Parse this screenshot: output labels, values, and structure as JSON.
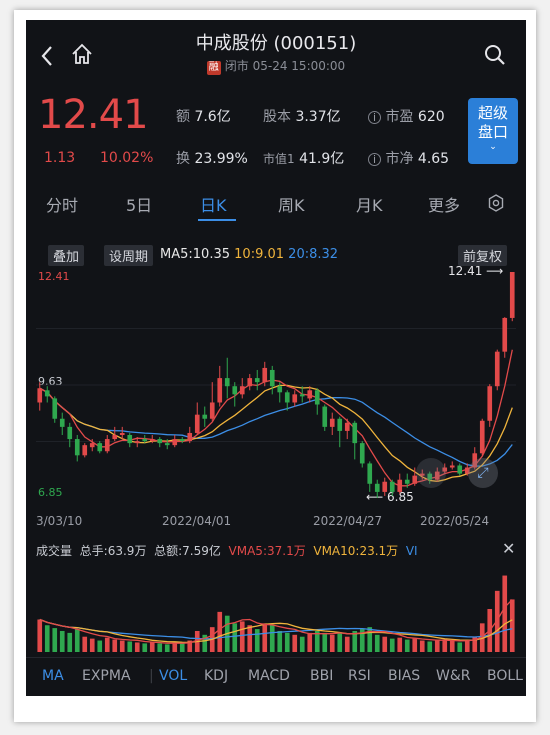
{
  "header": {
    "title": "中成股份 (000151)",
    "badge": "融",
    "status": "闭市 05-24 15:00:00"
  },
  "quote": {
    "price": "12.41",
    "change": "1.13",
    "change_pct": "10.02%",
    "stats": [
      {
        "label": "额",
        "value": "7.6亿"
      },
      {
        "label": "股本",
        "value": "3.37亿"
      },
      {
        "label": "市盈",
        "value": "620"
      },
      {
        "label": "换",
        "value": "23.99%"
      },
      {
        "label": "市值",
        "value": "41.9亿"
      },
      {
        "label": "市净",
        "value": "4.65"
      }
    ],
    "mktcap_suffix": "1",
    "super_button": [
      "超级",
      "盘口"
    ]
  },
  "tabs": [
    "分时",
    "5日",
    "日K",
    "周K",
    "月K",
    "更多"
  ],
  "active_tab": "日K",
  "chart_toolbar": {
    "overlay": "叠加",
    "period": "设周期",
    "ma_label": "MA5",
    "ma5": "10.35",
    "ma10_label": "10",
    "ma10": "9.01",
    "ma20_label": "20",
    "ma20": "8.32",
    "adjust": "前复权"
  },
  "price_axis": {
    "top": "12.41",
    "mid": "9.63",
    "bottom": "6.85",
    "high_marker": "12.41",
    "low_marker": "6.85"
  },
  "date_axis": [
    "3/03/10",
    "2022/04/01",
    "2022/04/27",
    "2022/05/24"
  ],
  "volume_header": {
    "title": "成交量",
    "hands_label": "总手",
    "hands": "63.9万",
    "amount_label": "总额",
    "amount": "7.59亿",
    "vma5_label": "VMA5",
    "vma5": "37.1万",
    "vma10_label": "VMA10",
    "vma10": "23.1万",
    "cut": "VI"
  },
  "indicator_tabs": [
    "MA",
    "EXPMA",
    "VOL",
    "KDJ",
    "MACD",
    "BBI",
    "RSI",
    "BIAS",
    "W&R",
    "BOLL"
  ],
  "colors": {
    "up": "#e24a4a",
    "down": "#2fa84f",
    "ma5": "#e8e8e8",
    "ma10": "#f0b43c",
    "ma20": "#3c8ee6",
    "accent": "#2b7fd8"
  },
  "chart_data": {
    "type": "candlestick",
    "x_labels": [
      "3/03/10",
      "2022/04/01",
      "2022/04/27",
      "2022/05/24"
    ],
    "ylim": [
      6.85,
      12.41
    ],
    "candles": [
      [
        9.2,
        9.55,
        9.7,
        9.0
      ],
      [
        9.5,
        9.35,
        9.6,
        9.2
      ],
      [
        9.3,
        8.8,
        9.35,
        8.7
      ],
      [
        8.8,
        8.6,
        8.95,
        8.4
      ],
      [
        8.6,
        8.3,
        8.7,
        8.1
      ],
      [
        8.3,
        7.9,
        8.4,
        7.75
      ],
      [
        7.9,
        8.15,
        8.2,
        7.85
      ],
      [
        8.1,
        8.2,
        8.3,
        8.0
      ],
      [
        8.2,
        8.0,
        8.25,
        7.95
      ],
      [
        8.0,
        8.3,
        8.4,
        7.95
      ],
      [
        8.3,
        8.4,
        8.6,
        8.25
      ],
      [
        8.4,
        8.45,
        8.6,
        8.3
      ],
      [
        8.4,
        8.2,
        8.45,
        8.1
      ],
      [
        8.2,
        8.25,
        8.35,
        8.1
      ],
      [
        8.3,
        8.25,
        8.4,
        8.2
      ],
      [
        8.25,
        8.3,
        8.4,
        8.2
      ],
      [
        8.3,
        8.2,
        8.35,
        8.1
      ],
      [
        8.2,
        8.15,
        8.3,
        8.05
      ],
      [
        8.15,
        8.3,
        8.4,
        8.1
      ],
      [
        8.3,
        8.25,
        8.35,
        8.2
      ],
      [
        8.25,
        8.45,
        8.6,
        8.2
      ],
      [
        8.45,
        8.9,
        9.2,
        8.4
      ],
      [
        8.9,
        8.8,
        9.1,
        8.6
      ],
      [
        8.8,
        9.2,
        9.7,
        8.75
      ],
      [
        9.2,
        9.8,
        10.1,
        9.1
      ],
      [
        9.8,
        9.6,
        10.3,
        9.3
      ],
      [
        9.6,
        9.4,
        9.7,
        9.1
      ],
      [
        9.4,
        9.6,
        9.8,
        9.3
      ],
      [
        9.6,
        9.8,
        9.9,
        9.5
      ],
      [
        9.8,
        9.7,
        10.0,
        9.5
      ],
      [
        9.7,
        10.05,
        10.2,
        9.6
      ],
      [
        10.0,
        9.6,
        10.1,
        9.4
      ],
      [
        9.6,
        9.45,
        9.7,
        9.2
      ],
      [
        9.45,
        9.2,
        9.5,
        9.0
      ],
      [
        9.2,
        9.4,
        9.5,
        9.1
      ],
      [
        9.4,
        9.35,
        9.6,
        9.2
      ],
      [
        9.3,
        9.5,
        9.6,
        9.2
      ],
      [
        9.5,
        9.15,
        9.55,
        8.9
      ],
      [
        9.1,
        8.6,
        9.15,
        8.5
      ],
      [
        8.6,
        8.8,
        8.95,
        8.4
      ],
      [
        8.8,
        8.5,
        8.85,
        8.1
      ],
      [
        8.5,
        8.7,
        8.8,
        8.3
      ],
      [
        8.7,
        8.2,
        8.75,
        7.8
      ],
      [
        8.2,
        7.7,
        8.25,
        7.6
      ],
      [
        7.7,
        7.2,
        7.75,
        7.0
      ],
      [
        7.2,
        7.0,
        7.3,
        6.85
      ],
      [
        7.0,
        7.25,
        7.35,
        6.9
      ],
      [
        7.25,
        7.0,
        7.3,
        6.9
      ],
      [
        7.0,
        7.3,
        7.45,
        6.95
      ],
      [
        7.3,
        7.2,
        7.45,
        7.1
      ],
      [
        7.2,
        7.4,
        7.6,
        7.15
      ],
      [
        7.4,
        7.45,
        7.55,
        7.3
      ],
      [
        7.45,
        7.3,
        7.5,
        7.2
      ],
      [
        7.3,
        7.5,
        7.6,
        7.25
      ],
      [
        7.5,
        7.6,
        7.7,
        7.45
      ],
      [
        7.6,
        7.65,
        7.75,
        7.55
      ],
      [
        7.65,
        7.45,
        7.7,
        7.4
      ],
      [
        7.45,
        7.6,
        7.7,
        7.4
      ],
      [
        7.6,
        7.95,
        8.1,
        7.55
      ],
      [
        7.95,
        8.75,
        8.8,
        7.9
      ],
      [
        8.75,
        9.6,
        9.65,
        8.6
      ],
      [
        9.6,
        10.45,
        10.5,
        9.5
      ],
      [
        10.45,
        11.28,
        11.3,
        10.3
      ],
      [
        11.28,
        12.41,
        12.41,
        11.2
      ]
    ],
    "volumes": [
      0.34,
      0.28,
      0.25,
      0.22,
      0.2,
      0.24,
      0.16,
      0.14,
      0.12,
      0.15,
      0.13,
      0.12,
      0.11,
      0.1,
      0.09,
      0.1,
      0.09,
      0.08,
      0.1,
      0.09,
      0.12,
      0.22,
      0.18,
      0.26,
      0.42,
      0.38,
      0.3,
      0.32,
      0.28,
      0.24,
      0.3,
      0.28,
      0.22,
      0.2,
      0.18,
      0.16,
      0.2,
      0.22,
      0.2,
      0.18,
      0.2,
      0.16,
      0.22,
      0.24,
      0.26,
      0.18,
      0.16,
      0.14,
      0.15,
      0.13,
      0.14,
      0.12,
      0.11,
      0.12,
      0.13,
      0.12,
      0.1,
      0.12,
      0.16,
      0.3,
      0.45,
      0.64,
      0.8,
      0.55
    ],
    "vol_max": 0.9
  }
}
